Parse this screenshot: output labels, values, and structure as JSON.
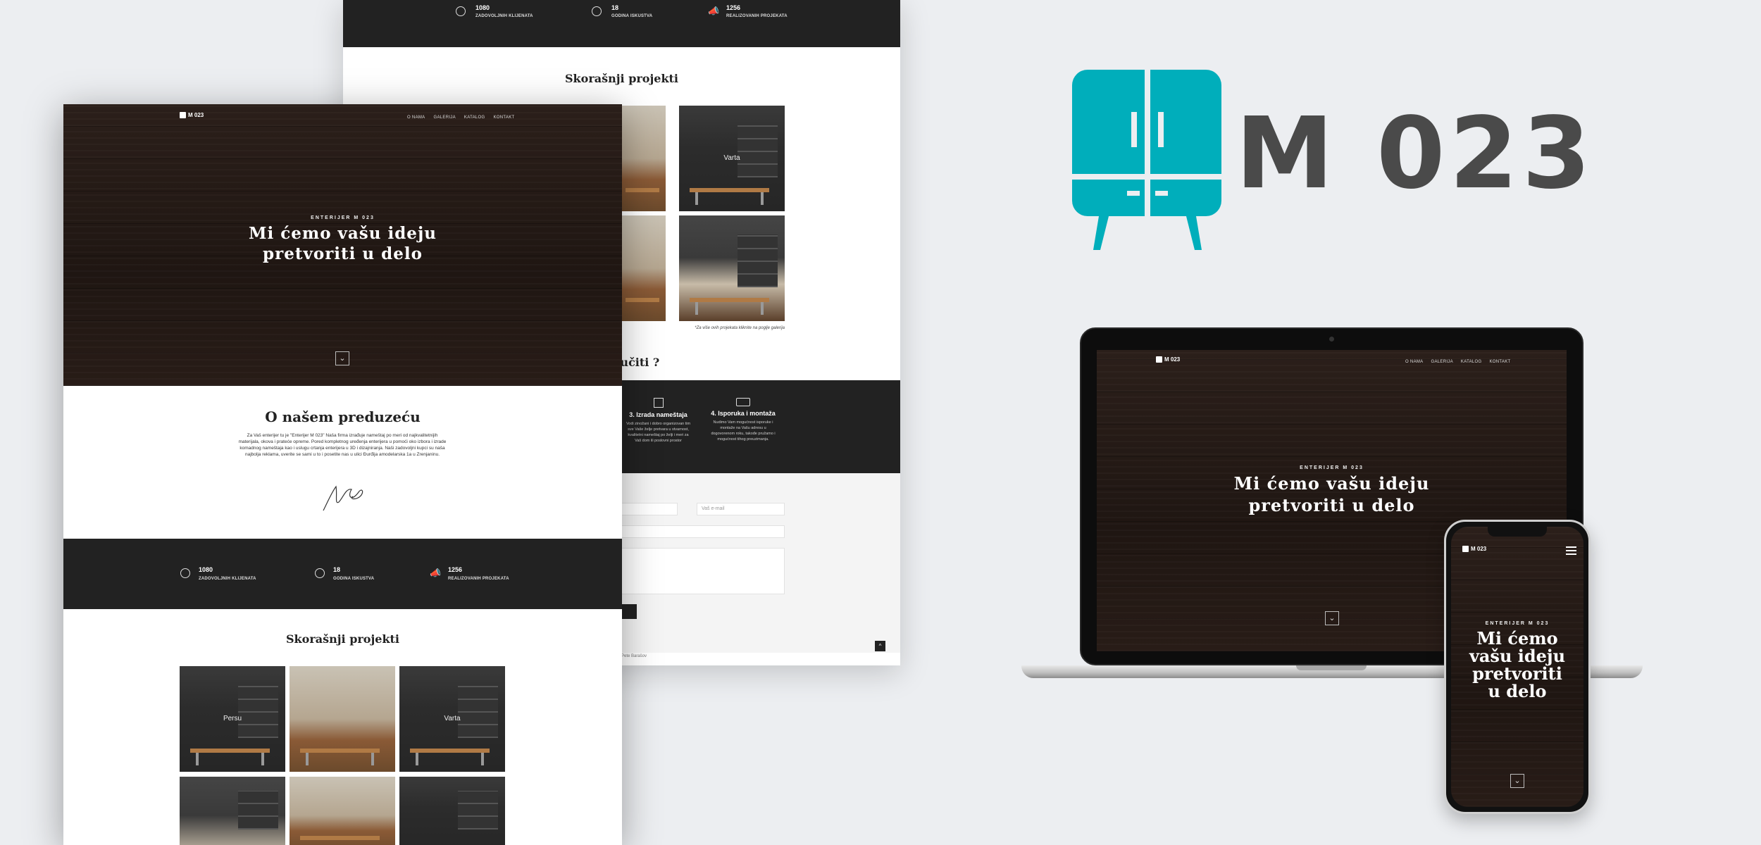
{
  "brand": {
    "logo_text": "M 023",
    "logo_small": "M 023",
    "accent_color": "#00aebb",
    "text_color": "#4a4a4a"
  },
  "nav": {
    "items": [
      "O NAMA",
      "GALERIJA",
      "KATALOG",
      "KONTAKT"
    ]
  },
  "hero": {
    "eyebrow": "ENTERIJER M 023",
    "line1": "Mi ćemo vašu ideju",
    "line2": "pretvoriti u delo",
    "mobile_line1": "Mi ćemo",
    "mobile_line2": "vašu ideju",
    "mobile_line3": "pretvoriti",
    "mobile_line4": "u delo"
  },
  "about": {
    "title": "O našem preduzeću",
    "body": "Za Vaš enterijer tu je \"Enterijer M 023\" Naša firma izrađuje nameštaj po meri od najkvalitetnijih materijala, okova i prateće opreme. Pored kompletnog uređenja enterijera u pomoći oko izbora i izrade komadnog nameštaja kao i uslugu crtanja enterijera u 3D i dizajniranja. Naši zadovoljni kupci su naša najbolja reklama, uverite se sami u to i posetite nas u ulici Đurđija amodelarska 1a u Zrenjaninu."
  },
  "stats": [
    {
      "num": "1080",
      "label": "ZADOVOLJNIH KLIJENATA",
      "icon": "smiley-icon"
    },
    {
      "num": "18",
      "label": "GODINA ISKUSTVA",
      "icon": "clock-icon"
    },
    {
      "num": "1256",
      "label": "REALIZOVANIH PROJEKATA",
      "icon": "megaphone-icon"
    }
  ],
  "projects": {
    "title": "Skorašnji projekti",
    "captions": [
      "Persu",
      "",
      "Varta"
    ],
    "note": "*Za više ovih projekata kliknite na poglje galerija"
  },
  "order": {
    "title_fragment": "ručiti ?",
    "steps": [
      {
        "title": "3. Izrada nameštaja",
        "text": "Vodi zinožani i dobro organizovan tim sve Vaše želje pretvara u stvarnost, kvalitetni nameštaj po želji i meri za Vaš dom ili poslovni prostor",
        "icon": "furniture-icon"
      },
      {
        "title": "4. Isporuka i montaža",
        "text": "Nudimo Vam mogućnost isporuke i montaže na Vašu adresu u dogovorenom roku, takođe pružamo i mogućnost tihog preuzimanja.",
        "icon": "truck-icon"
      }
    ]
  },
  "contact": {
    "email_placeholder": "Vaš e-mail"
  },
  "footer": {
    "credit": "Pete Barašov"
  }
}
